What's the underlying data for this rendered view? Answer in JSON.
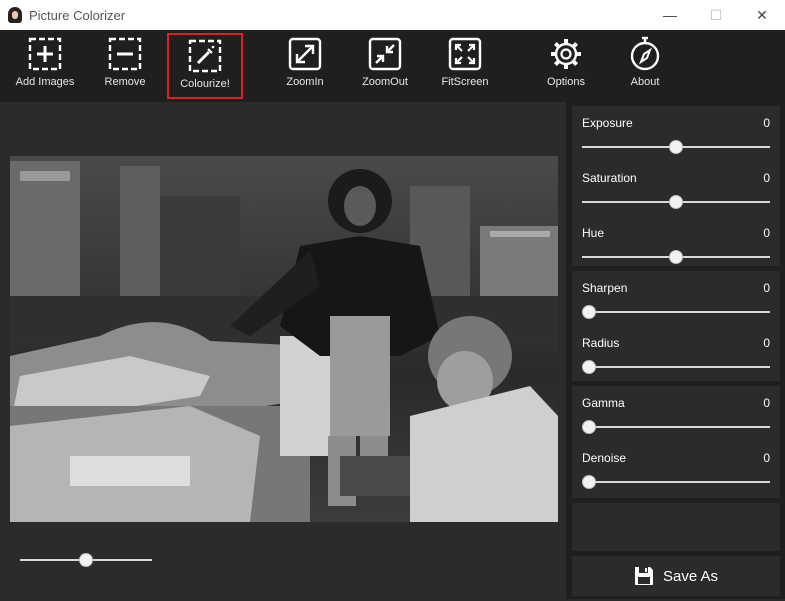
{
  "window": {
    "title": "Picture Colorizer",
    "minimize_glyph": "—",
    "maximize_glyph": "☐",
    "close_glyph": "✕"
  },
  "toolbar": {
    "items": [
      {
        "label": "Add Images",
        "icon": "add-images-icon"
      },
      {
        "label": "Remove",
        "icon": "remove-icon"
      },
      {
        "label": "Colourize!",
        "icon": "colourize-wand-icon",
        "highlighted": true
      },
      {
        "label": "ZoomIn",
        "icon": "zoom-in-icon"
      },
      {
        "label": "ZoomOut",
        "icon": "zoom-out-icon"
      },
      {
        "label": "FitScreen",
        "icon": "fit-screen-icon"
      },
      {
        "label": "Options",
        "icon": "gear-icon"
      },
      {
        "label": "About",
        "icon": "compass-icon"
      }
    ]
  },
  "preview": {
    "zoom_level": 0.5
  },
  "adjustments": {
    "exposure": {
      "label": "Exposure",
      "value": "0",
      "level": 0.5
    },
    "saturation": {
      "label": "Saturation",
      "value": "0",
      "level": 0.5
    },
    "hue": {
      "label": "Hue",
      "value": "0",
      "level": 0.5
    },
    "sharpen": {
      "label": "Sharpen",
      "value": "0",
      "level": 0
    },
    "radius": {
      "label": "Radius",
      "value": "0",
      "level": 0
    },
    "gamma": {
      "label": "Gamma",
      "value": "0",
      "level": 0
    },
    "denoise": {
      "label": "Denoise",
      "value": "0",
      "level": 0
    }
  },
  "save": {
    "label": "Save As",
    "icon": "floppy-disk-icon"
  },
  "colors": {
    "highlight_border": "#e02020",
    "toolbar_bg": "#1f1f1f",
    "panel_bg": "#2b2b2b"
  }
}
